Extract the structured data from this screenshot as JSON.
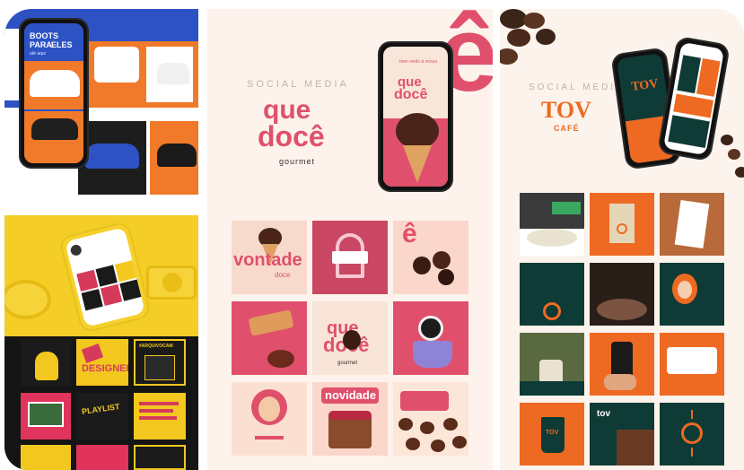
{
  "panelA": {
    "phone_text": [
      "BOOTS",
      "PARA",
      "ELES"
    ],
    "phone_small": "até aqui"
  },
  "panelB": {
    "tiles": [
      "DESIGNER",
      "PLAYLIST",
      "#ARQUIVOCAM"
    ]
  },
  "panelC": {
    "social_media": "SOCIAL MEDIA",
    "logo_line1": "que",
    "logo_line2": "docê",
    "logo_sub": "gourmet",
    "big_letter": "ê",
    "phone_caption": "bem vindo à nossa",
    "tile_vontade": "vontade",
    "tile_doce": "doce",
    "tile_novidade": "novidade",
    "tile_gourmet": "gourmet"
  },
  "panelD": {
    "social_media": "SOCIAL MEDIA",
    "logo": "TOV",
    "logo_sub": "CAFÉ",
    "tile_tov": "tov",
    "tile_brand": "TOV"
  },
  "colors": {
    "pink": "#e0506c",
    "orange": "#ee6a22",
    "teal": "#0f3b36",
    "yellow": "#f2c81f"
  }
}
